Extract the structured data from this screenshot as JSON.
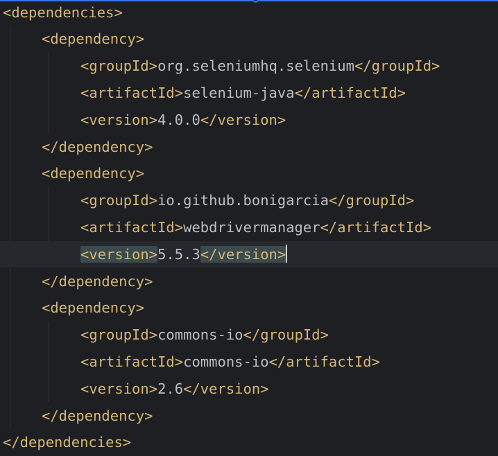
{
  "editor": {
    "lines": [
      {
        "parts": [
          {
            "t": "tag",
            "v": "<dependencies>"
          }
        ]
      },
      {
        "parts": [
          {
            "t": "tag",
            "v": "<dependency>"
          }
        ]
      },
      {
        "parts": [
          {
            "t": "tag",
            "v": "<groupId>"
          },
          {
            "t": "txt",
            "v": "org.seleniumhq.selenium"
          },
          {
            "t": "tag",
            "v": "</groupId>"
          }
        ]
      },
      {
        "parts": [
          {
            "t": "tag",
            "v": "<artifactId>"
          },
          {
            "t": "txt",
            "v": "selenium-java"
          },
          {
            "t": "tag",
            "v": "</artifactId>"
          }
        ]
      },
      {
        "parts": [
          {
            "t": "tag",
            "v": "<version>"
          },
          {
            "t": "txt",
            "v": "4.0.0"
          },
          {
            "t": "tag",
            "v": "</version>"
          }
        ]
      },
      {
        "parts": [
          {
            "t": "tag",
            "v": "</dependency>"
          }
        ]
      },
      {
        "parts": [
          {
            "t": "tag",
            "v": "<dependency>"
          }
        ]
      },
      {
        "parts": [
          {
            "t": "tag",
            "v": "<groupId>"
          },
          {
            "t": "txt",
            "v": "io.github.bonigarcia"
          },
          {
            "t": "tag",
            "v": "</groupId>"
          }
        ]
      },
      {
        "parts": [
          {
            "t": "tag",
            "v": "<artifactId>"
          },
          {
            "t": "txt",
            "v": "webdrivermanager"
          },
          {
            "t": "tag",
            "v": "</artifactId>"
          }
        ]
      },
      {
        "parts": [
          {
            "t": "tag hl",
            "v": "<version>"
          },
          {
            "t": "txt",
            "v": "5.5.3"
          },
          {
            "t": "tag hl",
            "v": "</version>"
          }
        ],
        "current": true,
        "caret": true
      },
      {
        "parts": [
          {
            "t": "tag",
            "v": "</dependency>"
          }
        ]
      },
      {
        "parts": [
          {
            "t": "tag",
            "v": "<dependency>"
          }
        ]
      },
      {
        "parts": [
          {
            "t": "tag",
            "v": "<groupId>"
          },
          {
            "t": "txt",
            "v": "commons-io"
          },
          {
            "t": "tag",
            "v": "</groupId>"
          }
        ]
      },
      {
        "parts": [
          {
            "t": "tag",
            "v": "<artifactId>"
          },
          {
            "t": "txt",
            "v": "commons-io"
          },
          {
            "t": "tag",
            "v": "</artifactId>"
          }
        ]
      },
      {
        "parts": [
          {
            "t": "tag",
            "v": "<version>"
          },
          {
            "t": "txt",
            "v": "2.6"
          },
          {
            "t": "tag",
            "v": "</version>"
          }
        ]
      },
      {
        "parts": [
          {
            "t": "tag",
            "v": "</dependency>"
          }
        ]
      },
      {
        "parts": [
          {
            "t": "tag",
            "v": "</dependencies>"
          }
        ]
      }
    ]
  },
  "colors": {
    "background": "#1e1f22",
    "tag": "#d5b778",
    "text": "#bcbec4",
    "current_line": "#26282e",
    "tag_match_highlight": "#3b4a4c",
    "accent": "#3574f0"
  }
}
